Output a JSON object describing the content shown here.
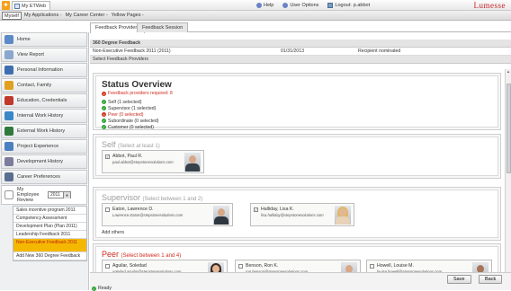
{
  "topbar": {
    "app_tab": "My ETWeb",
    "help": "Help",
    "user_options": "User Options",
    "logout": "Logout:",
    "username": "p.abbot",
    "brand": "Lumesse",
    "brand_color": "#c8262b"
  },
  "navbar": {
    "myself": "Myself",
    "crumbs": [
      "My Applications -",
      "My Career Center -",
      "Yellow Pages -"
    ]
  },
  "sidebar": {
    "items": [
      {
        "label": "Home",
        "icon": "home-icon",
        "color": "#5d89c8"
      },
      {
        "label": "View Report",
        "icon": "report-icon",
        "color": "#8aa8cf"
      },
      {
        "label": "Personal Information",
        "icon": "personal-info-icon",
        "color": "#3d6fb0"
      },
      {
        "label": "Contact, Family",
        "icon": "contact-family-icon",
        "color": "#e0a020"
      },
      {
        "label": "Education, Credentials",
        "icon": "education-icon",
        "color": "#c0392b"
      },
      {
        "label": "Internal Work History",
        "icon": "internal-history-icon",
        "color": "#3a87c8"
      },
      {
        "label": "External Work History",
        "icon": "external-history-icon",
        "color": "#2f7a3c"
      },
      {
        "label": "Project Experience",
        "icon": "project-icon",
        "color": "#4a7fc0"
      },
      {
        "label": "Development History",
        "icon": "development-icon",
        "color": "#7c7c9c"
      },
      {
        "label": "Career Preferences",
        "icon": "career-icon",
        "color": "#5a6f8f"
      }
    ],
    "review": {
      "label": "My Employee Review",
      "year": "2011",
      "icon": "review-icon"
    },
    "subitems": [
      {
        "label": "Sales incentive program 2011",
        "active": false
      },
      {
        "label": "Competency Assessment",
        "active": false
      },
      {
        "label": "Development Plan (Plan 2011)",
        "active": false
      },
      {
        "label": "Leadership Feedback 2011",
        "active": false
      },
      {
        "label": "Non-Executive Feedback 2011",
        "active": true
      },
      {
        "label": "Add New 360 Degree Feedback",
        "active": false
      }
    ]
  },
  "tabs": [
    "Feedback Providers",
    "Feedback Session"
  ],
  "feedback": {
    "section_title": "360 Degree Feedback",
    "name": "Non-Executive Feedback 2011 (2011)",
    "date": "01/31/2013",
    "status": "Recipient nominated",
    "select_title": "Select Feedback Providers"
  },
  "status_overview": {
    "title": "Status Overview",
    "required": "Feedback providers required: 8",
    "items": [
      {
        "label": "Self (1 selected)",
        "ok": true
      },
      {
        "label": "Supervisor (1 selected)",
        "ok": true
      },
      {
        "label": "Peer (0 selected)",
        "ok": false
      },
      {
        "label": "Subordinate (0 selected)",
        "ok": true
      },
      {
        "label": "Customer (0 selected)",
        "ok": true
      }
    ]
  },
  "self_group": {
    "title": "Self",
    "rule": "(Select at least 1)",
    "person": {
      "name": "Abbot, Paul R.",
      "email": "paul.abbot@stepstonesolutions.com",
      "checked": true
    }
  },
  "supervisor_group": {
    "title": "Supervisor",
    "rule": "(Select between 1 and 2)",
    "people": [
      {
        "name": "Eaton, Lawrence D.",
        "email": "Lawrence.Eaton@stepstonesolutions.com",
        "checked": false
      },
      {
        "name": "Halliday, Lisa K.",
        "email": "lisa.halliday@stepstonesolutions.com",
        "checked": true
      }
    ],
    "add_others": "Add others"
  },
  "peer_group": {
    "title": "Peer",
    "rule": "(Select between 1 and 4)",
    "people": [
      {
        "name": "Aguilar, Soledad",
        "email": "soledad.aguilar@stepstonesolutions.com",
        "checked": false
      },
      {
        "name": "Benson, Ron K.",
        "email": "ron.benson@stepstonesolutions.com",
        "checked": false
      },
      {
        "name": "Howell, Louise M.",
        "email": "louise.howell@stepstonesolutions.com",
        "checked": false
      }
    ]
  },
  "buttons": {
    "save": "Save",
    "back": "Back"
  },
  "statusbar": {
    "ready": "Ready"
  }
}
